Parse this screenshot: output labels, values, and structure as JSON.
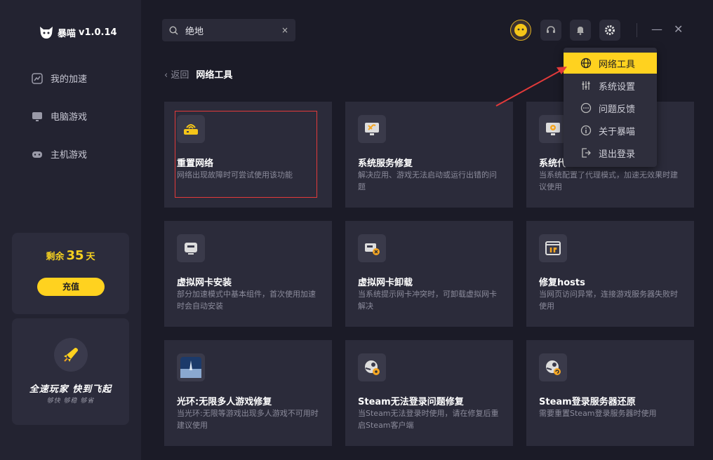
{
  "app": {
    "name": "暴喵",
    "version": "v1.0.14"
  },
  "sidebar": {
    "items": [
      {
        "label": "我的加速",
        "icon": "speed-icon"
      },
      {
        "label": "电脑游戏",
        "icon": "monitor-icon"
      },
      {
        "label": "主机游戏",
        "icon": "gamepad-icon"
      }
    ],
    "balance": {
      "prefix": "剩余",
      "days": "35",
      "suffix": "天",
      "recharge_label": "充值"
    },
    "promo": {
      "title": "全速玩家  快到飞起",
      "subtitle": "够快  够稳  够省"
    }
  },
  "search": {
    "value": "绝地",
    "clear": "×"
  },
  "breadcrumb": {
    "back": "返回",
    "title": "网络工具"
  },
  "menu": {
    "items": [
      {
        "label": "网络工具",
        "icon": "globe-icon",
        "active": true
      },
      {
        "label": "系统设置",
        "icon": "sliders-icon"
      },
      {
        "label": "问题反馈",
        "icon": "chat-icon"
      },
      {
        "label": "关于暴喵",
        "icon": "info-icon"
      },
      {
        "label": "退出登录",
        "icon": "logout-icon"
      }
    ]
  },
  "tools": [
    {
      "title": "重置网络",
      "desc": "网络出现故障时可尝试使用该功能",
      "icon": "router-icon"
    },
    {
      "title": "系统服务修复",
      "desc": "解决应用、游戏无法启动或运行出错的问题",
      "icon": "system-repair-icon"
    },
    {
      "title": "系统代",
      "desc": "当系统配置了代理模式，加速无效果时建议使用",
      "icon": "system-proxy-icon"
    },
    {
      "title": "虚拟网卡安装",
      "desc": "部分加速模式中基本组件，首次使用加速时会自动安装",
      "icon": "network-card-icon"
    },
    {
      "title": "虚拟网卡卸载",
      "desc": "当系统提示网卡冲突时，可卸载虚拟网卡解决",
      "icon": "network-card-remove-icon"
    },
    {
      "title": "修复hosts",
      "desc": "当网页访问异常，连接游戏服务器失败时使用",
      "icon": "hosts-icon"
    },
    {
      "title": "光环:无限多人游戏修复",
      "desc": "当光环:无限等游戏出现多人游戏不可用时建议使用",
      "icon": "halo-game-icon"
    },
    {
      "title": "Steam无法登录问题修复",
      "desc": "当Steam无法登录时使用，请在修复后重启Steam客户端",
      "icon": "steam-repair-icon"
    },
    {
      "title": "Steam登录服务器还原",
      "desc": "需要重置Steam登录服务器时使用",
      "icon": "steam-restore-icon"
    }
  ]
}
